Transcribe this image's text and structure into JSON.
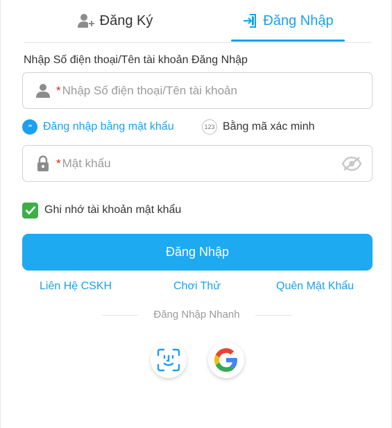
{
  "tabs": {
    "register": {
      "label": "Đăng Ký",
      "icon": "add-user-icon"
    },
    "login": {
      "label": "Đăng Nhập",
      "icon": "login-door-icon",
      "active": true
    }
  },
  "form": {
    "section_label": "Nhập Số điện thoại/Tên tài khoản Đăng Nhập",
    "account": {
      "required_mark": "*",
      "placeholder": "Nhập Số điện thoại/Tên tài khoản",
      "value": "",
      "icon": "user-icon"
    },
    "password": {
      "required_mark": "*",
      "placeholder": "Mật khẩu",
      "value": "",
      "icon": "lock-icon",
      "toggle_icon": "eye-hidden-icon"
    },
    "modes": {
      "password": {
        "label": "Đăng nhập bằng mật khẩu",
        "badge": "**",
        "selected": true
      },
      "code": {
        "label": "Bằng mã xác minh",
        "badge": "123",
        "selected": false
      }
    },
    "remember": {
      "label": "Ghi nhớ tài khoản mật khẩu",
      "checked": true
    },
    "submit_label": "Đăng Nhập"
  },
  "links": {
    "support": "Liên Hệ CSKH",
    "trial": "Chơi Thử",
    "forgot": "Quên Mật Khẩu"
  },
  "quick_login": {
    "label": "Đăng Nhập Nhanh",
    "options": [
      {
        "name": "face-id",
        "icon": "face-id-icon"
      },
      {
        "name": "google",
        "icon": "google-icon"
      }
    ]
  },
  "colors": {
    "accent": "#1aa0ef",
    "button": "#1eaaf1",
    "checkbox": "#3fae49",
    "required": "#e02020"
  }
}
